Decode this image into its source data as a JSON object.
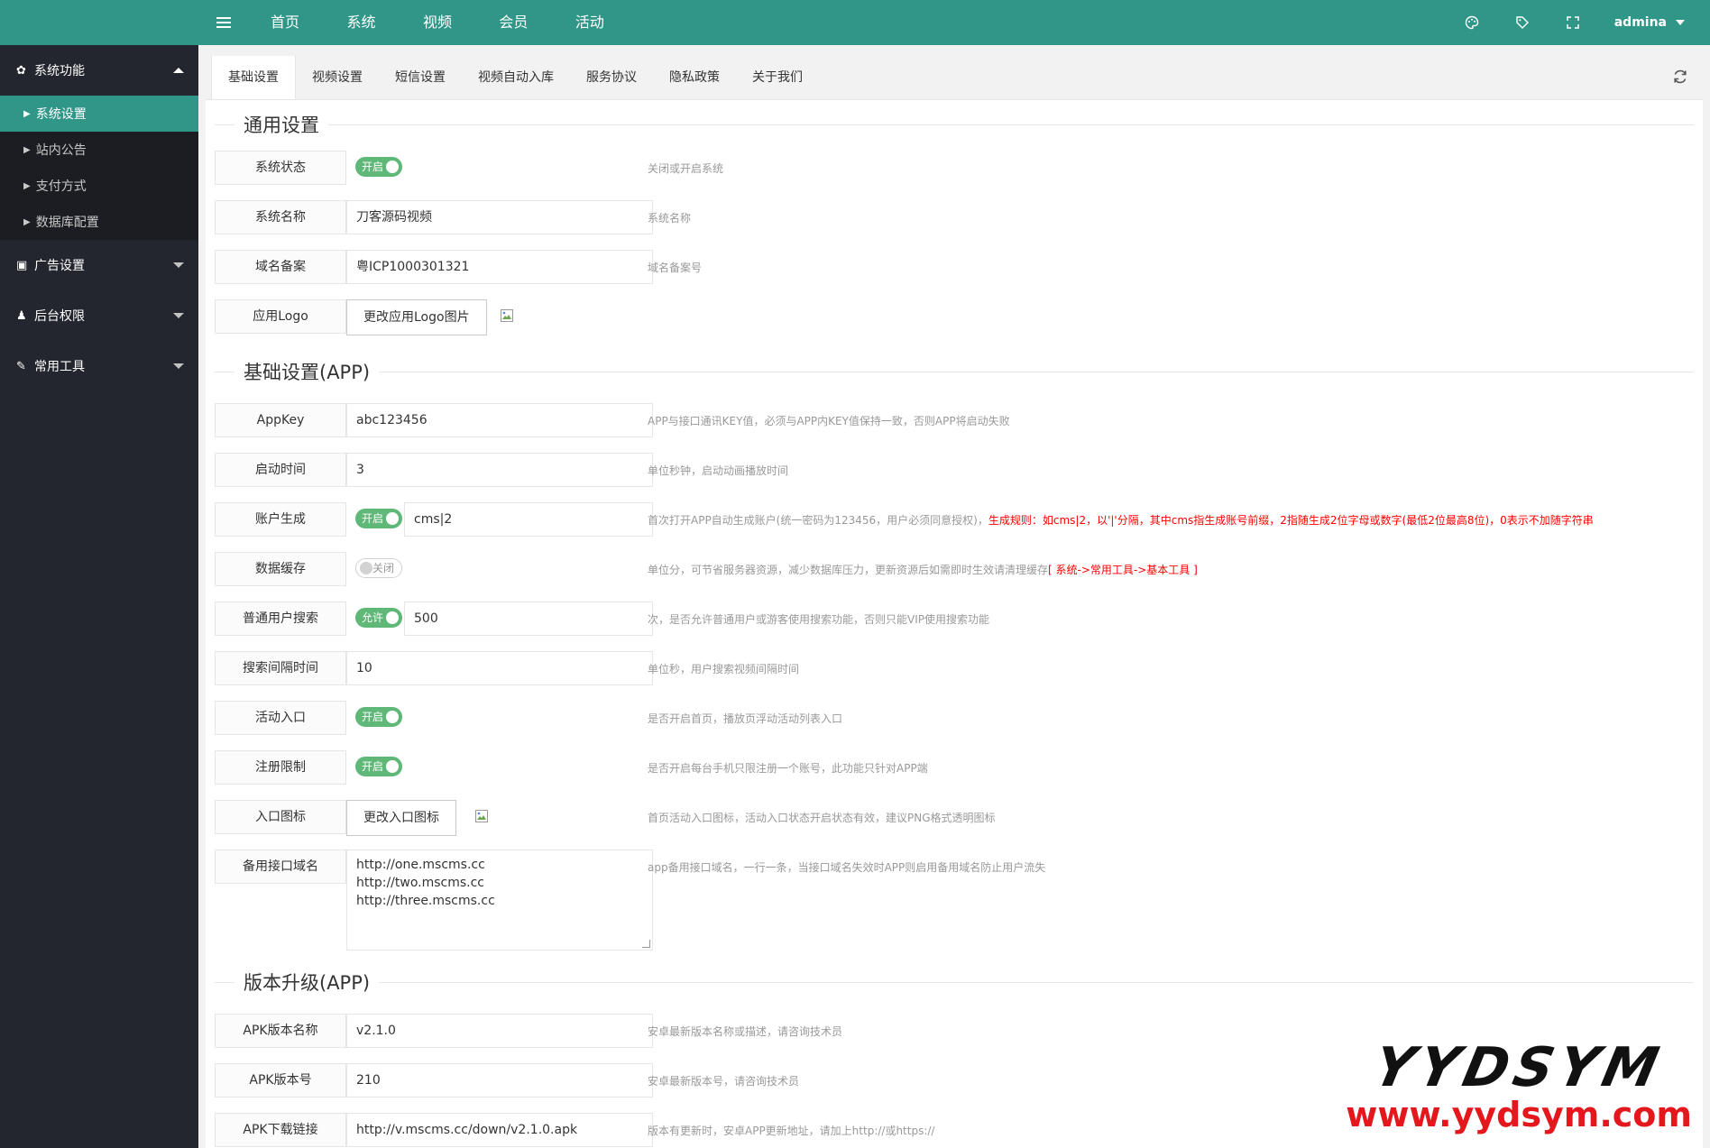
{
  "app": {
    "appkey": {
      "label": "AppKey",
      "value": "abc123456",
      "help": "APP与接口通讯KEY值，必须与APP内KEY值保持一致，否则APP将启动失败"
    },
    "launch": {
      "label": "启动时间",
      "value": "3",
      "help": "单位秒钟，启动动画播放时间"
    },
    "account": {
      "label": "账户生成",
      "switch": "开启",
      "value": "cms|2",
      "help": "首次打开APP自动生成账户(统一密码为123456，用户必须同意授权)，",
      "help_red": "生成规则：如cms|2，以'|'分隔，其中cms指生成账号前缀，2指随生成2位字母或数字(最低2位最高8位)，0表示不加随字符串"
    },
    "cache": {
      "label": "数据缓存",
      "switch": "关闭",
      "help": "单位分，可节省服务器资源，减少数据库压力，更新资源后如需即时生效请清理缓存",
      "help_red": "[ 系统->常用工具->基本工具 ]"
    },
    "search": {
      "label": "普通用户搜索",
      "switch": "允许",
      "value": "500",
      "help": "次，是否允许普通用户或游客使用搜索功能，否则只能VIP使用搜索功能"
    },
    "interval": {
      "label": "搜索间隔时间",
      "value": "10",
      "help": "单位秒，用户搜索视频间隔时间"
    },
    "activity": {
      "label": "活动入口",
      "switch": "开启",
      "help": "是否开启首页，播放页浮动活动列表入口"
    },
    "register": {
      "label": "注册限制",
      "switch": "开启",
      "help": "是否开启每台手机只限注册一个账号，此功能只针对APP端"
    },
    "entry_icon": {
      "label": "入口图标",
      "button": "更改入口图标",
      "help": "首页活动入口图标，活动入口状态开启状态有效，建议PNG格式透明图标"
    },
    "backup": {
      "label": "备用接口域名",
      "lines": [
        "http://one.mscms.cc",
        "http://two.mscms.cc",
        "http://three.mscms.cc"
      ],
      "help": "app备用接口域名，一行一条，当接口域名失效时APP则启用备用域名防止用户流失"
    }
  },
  "topnav": [
    "首页",
    "系统",
    "视频",
    "会员",
    "活动"
  ],
  "topbar": {
    "user": "admina"
  },
  "sidebar": {
    "group_system": "系统功能",
    "system_items": [
      "系统设置",
      "站内公告",
      "支付方式",
      "数据库配置"
    ],
    "group_ads": "广告设置",
    "group_perm": "后台权限",
    "group_tools": "常用工具"
  },
  "tabs": [
    "基础设置",
    "视频设置",
    "短信设置",
    "视频自动入库",
    "服务协议",
    "隐私政策",
    "关于我们"
  ],
  "sections": {
    "general": "通用设置",
    "app": "基础设置(APP)",
    "upgrade": "版本升级(APP)"
  },
  "general": {
    "status": {
      "label": "系统状态",
      "switch": "开启",
      "help": "关闭或开启系统"
    },
    "name": {
      "label": "系统名称",
      "value": "刀客源码视频",
      "help": "系统名称"
    },
    "icp": {
      "label": "域名备案",
      "value": "粤ICP1000301321",
      "help": "域名备案号"
    },
    "logo": {
      "label": "应用Logo",
      "button": "更改应用Logo图片"
    }
  },
  "upgrade": {
    "apk_name": {
      "label": "APK版本名称",
      "value": "v2.1.0",
      "help": "安卓最新版本名称或描述，请咨询技术员"
    },
    "apk_code": {
      "label": "APK版本号",
      "value": "210",
      "help": "安卓最新版本号，请咨询技术员"
    },
    "apk_url": {
      "label": "APK下载链接",
      "value": "http://v.mscms.cc/down/v2.1.0.apk",
      "help": "版本有更新时，安卓APP更新地址，请加上http://或https://"
    }
  },
  "watermark": {
    "line1": "YYDSYM",
    "line2": "www.yydsym.com"
  },
  "colors": {
    "primary": "#2f9688",
    "sidebar": "#23262e",
    "switch_on": "#5fb878",
    "warn": "#ff0000"
  }
}
